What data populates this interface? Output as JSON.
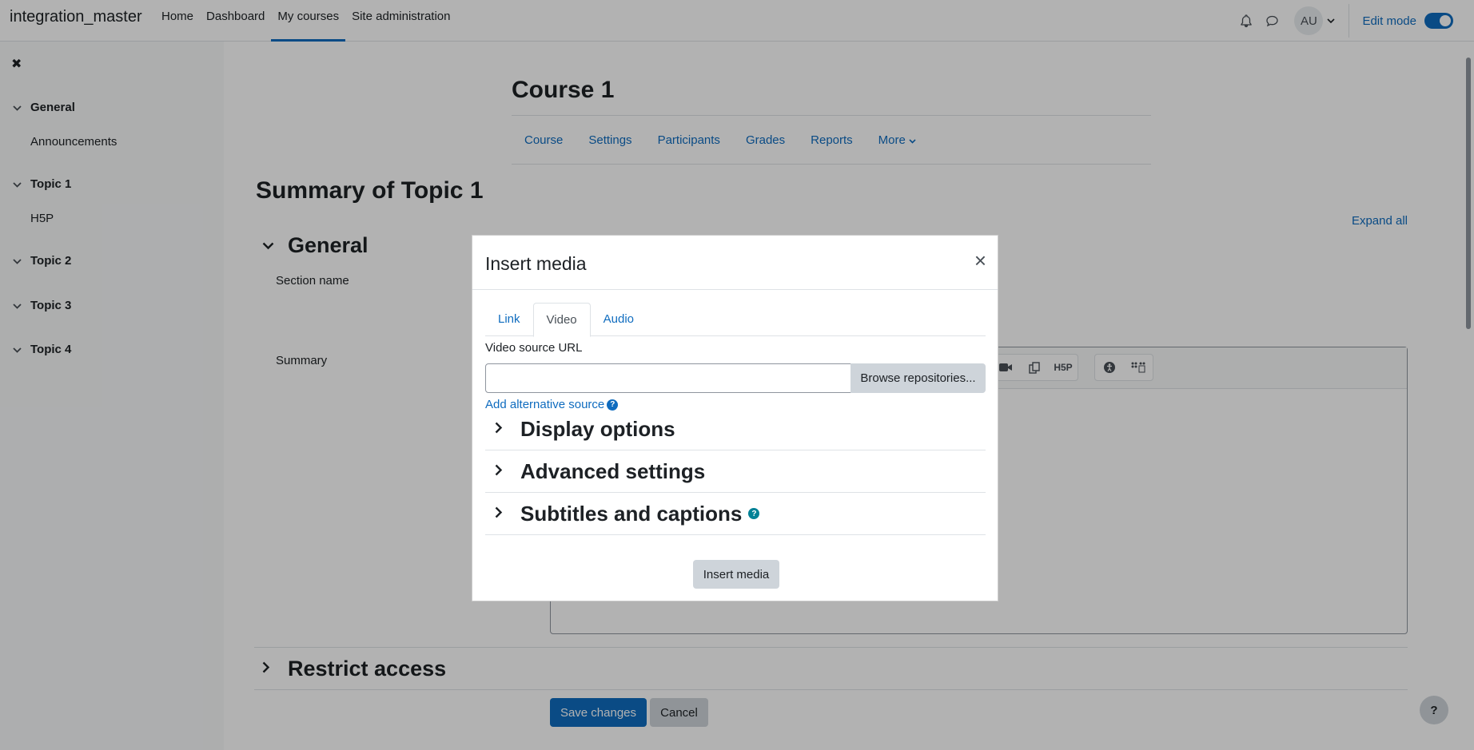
{
  "navbar": {
    "brand": "integration_master",
    "items": [
      "Home",
      "Dashboard",
      "My courses",
      "Site administration"
    ],
    "active_index": 2,
    "avatar_initials": "AU",
    "edit_mode_label": "Edit mode",
    "edit_mode_on": true
  },
  "course_index": {
    "sections": [
      {
        "title": "General",
        "items": [
          "Announcements"
        ]
      },
      {
        "title": "Topic 1",
        "items": [
          "H5P"
        ]
      },
      {
        "title": "Topic 2",
        "items": []
      },
      {
        "title": "Topic 3",
        "items": []
      },
      {
        "title": "Topic 4",
        "items": []
      }
    ]
  },
  "course": {
    "title": "Course 1",
    "secondary_nav": [
      "Course",
      "Settings",
      "Participants",
      "Grades",
      "Reports",
      "More"
    ]
  },
  "page": {
    "heading": "Summary of Topic 1",
    "expand_all": "Expand all",
    "general_section": "General",
    "section_name_label": "Section name",
    "summary_label": "Summary",
    "restrict_access": "Restrict access",
    "save_button": "Save changes",
    "cancel_button": "Cancel",
    "help_button": "?"
  },
  "modal": {
    "title": "Insert media",
    "close": "×",
    "tabs": [
      "Link",
      "Video",
      "Audio"
    ],
    "active_tab": 1,
    "video_source_label": "Video source URL",
    "video_source_value": "",
    "browse_button": "Browse repositories...",
    "add_alternative": "Add alternative source",
    "sections": [
      "Display options",
      "Advanced settings",
      "Subtitles and captions"
    ],
    "insert_button": "Insert media"
  },
  "colors": {
    "accent": "#0f6cbf",
    "help_teal": "#008196",
    "secondary_button": "#ced4da"
  }
}
